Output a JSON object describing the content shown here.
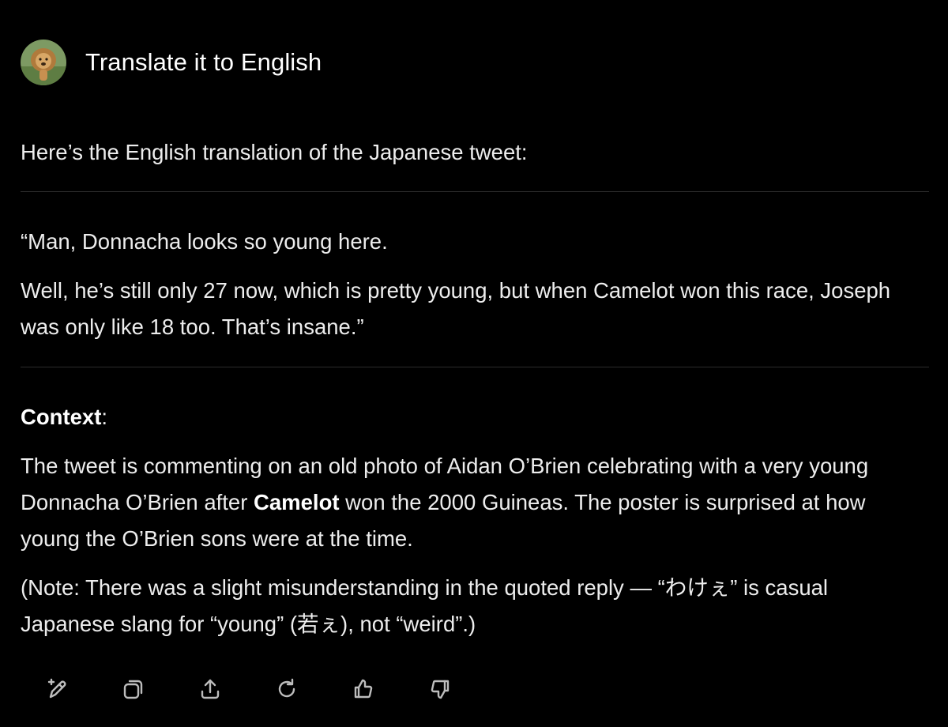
{
  "user_message": {
    "text": "Translate it to English"
  },
  "response": {
    "intro": "Here’s the English translation of the Japanese tweet:",
    "quote_line1": "“Man, Donnacha looks so young here.",
    "quote_line2": "Well, he’s still only 27 now, which is pretty young, but when Camelot won this race, Joseph was only like 18 too. That’s insane.”",
    "context_heading": "Context",
    "context_heading_colon": ":",
    "context_part1": "The tweet is commenting on an old photo of Aidan O’Brien celebrating with a very young Donnacha O’Brien after ",
    "context_bold": "Camelot",
    "context_part2": " won the 2000 Guineas. The poster is surprised at how young the O’Brien sons were at the time.",
    "note": "(Note: There was a slight misunderstanding in the quoted reply — “わけぇ” is casual Japanese slang for “young” (若ぇ), not “weird”.)"
  },
  "actions": [
    {
      "icon": "edit-sparkle-icon"
    },
    {
      "icon": "copy-icon"
    },
    {
      "icon": "share-icon"
    },
    {
      "icon": "regenerate-icon"
    },
    {
      "icon": "thumbs-up-icon"
    },
    {
      "icon": "thumbs-down-icon"
    }
  ],
  "colors": {
    "background": "#000000",
    "text": "#ededed",
    "divider": "#2c2c2c",
    "icon": "#bdbdbd"
  }
}
